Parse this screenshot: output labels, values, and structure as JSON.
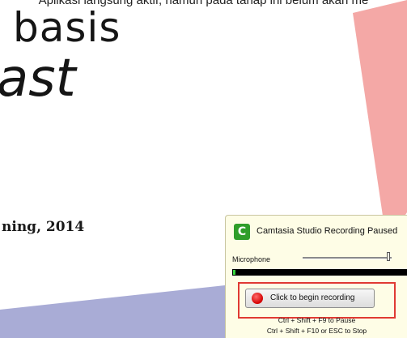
{
  "slide": {
    "top_caption": "Aplikasi langsung aktif, namun pada tahap ini belum akan me",
    "title_fragment_1": "basis",
    "title_fragment_2": "ast",
    "date_fragment": "ning, 2014"
  },
  "recorder": {
    "title": "Camtasia Studio Recording Paused",
    "microphone_label": "Microphone",
    "microphone_level": 0.95,
    "begin_button_label": "Click to begin recording",
    "pause_hint": "Ctrl + Shift + F9  to Pause",
    "stop_hint": "Ctrl + Shift + F10 or ESC to Stop",
    "icons": {
      "logo": "camtasia-logo-icon",
      "record": "record-dot-icon"
    }
  },
  "colors": {
    "pink_shape": "#f4a8a6",
    "blue_shape": "#a9acd6",
    "panel_bg": "#fefde6",
    "highlight": "#e03a33"
  }
}
